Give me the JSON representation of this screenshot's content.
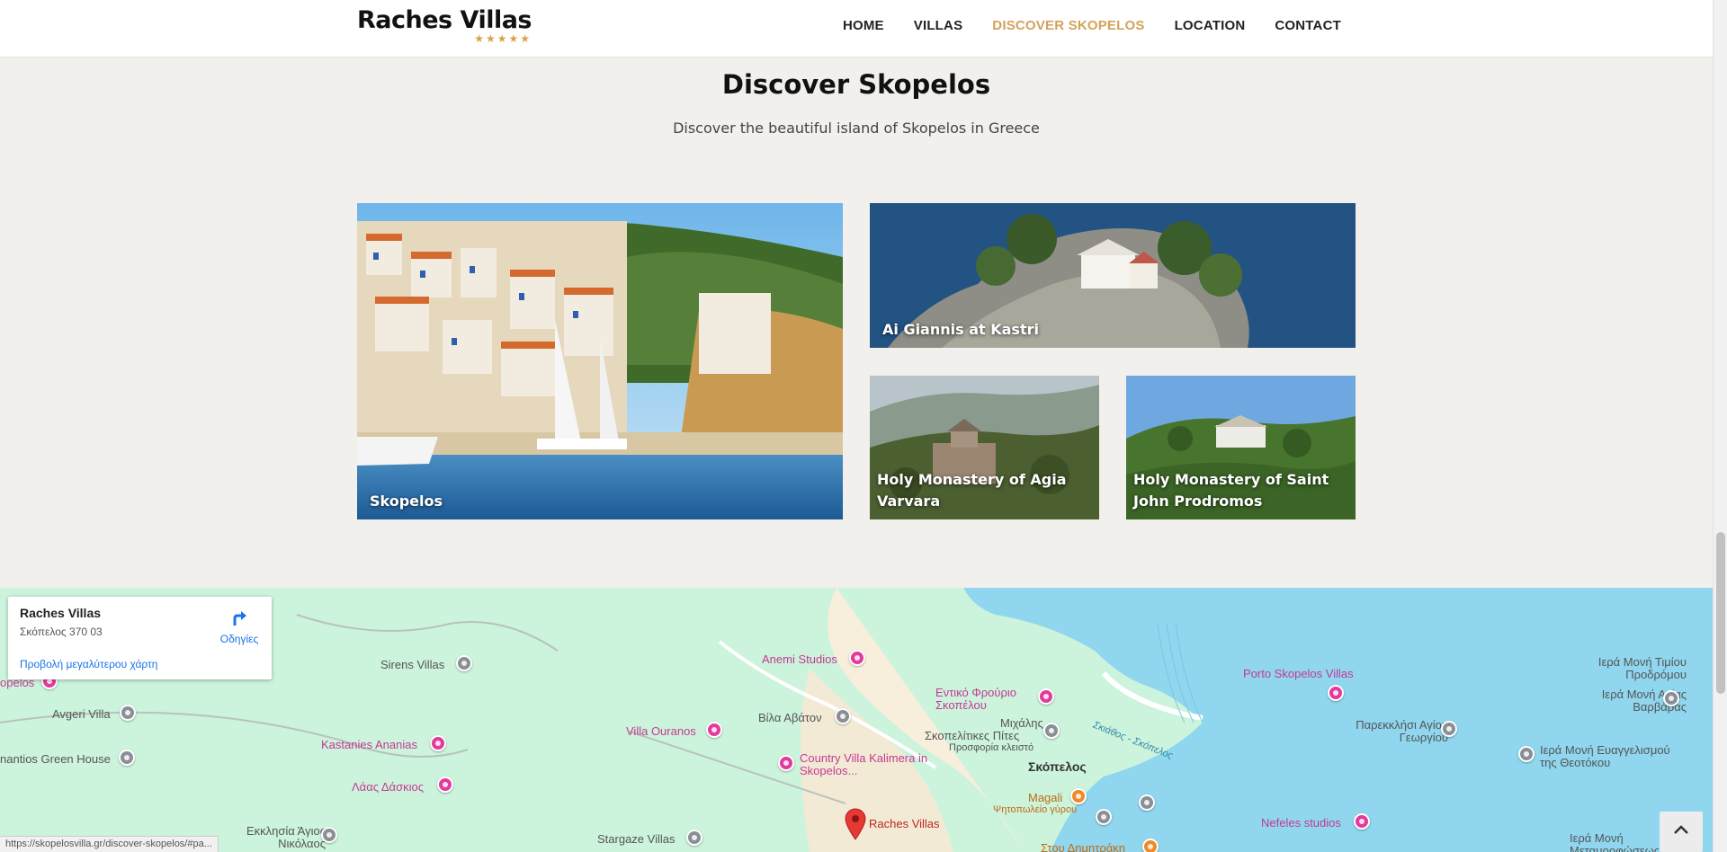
{
  "header": {
    "logo": "Raches Villas",
    "stars": "★★★★★",
    "nav": [
      "HOME",
      "VILLAS",
      "DISCOVER SKOPELOS",
      "LOCATION",
      "CONTACT"
    ]
  },
  "page": {
    "title": "Discover Skopelos",
    "subtitle": "Discover the beautiful island of Skopelos in Greece"
  },
  "cards": [
    {
      "label": "Skopelos"
    },
    {
      "label": "Ai Giannis at Kastri"
    },
    {
      "label": "Holy Monastery of Agia Varvara"
    },
    {
      "label": "Holy Monastery of Saint John Prodromos"
    }
  ],
  "map": {
    "info": {
      "title": "Raches Villas",
      "address": "Σκόπελος 370 03",
      "directions": "Οδηγίες",
      "larger_map": "Προβολή μεγαλύτερου χάρτη"
    },
    "places": [
      "Sirens Villas",
      "Anemi Studios",
      "Εντικό Φρούριο Σκοπέλου",
      "Porto Skopelos Villas",
      "Ιερά Μονή Τιμίου Προδρόμου",
      "Ιερά Μονή Αγίας Βαρβάρας",
      "Avgeri Villa",
      "Βίλα Αβάτον",
      "Μιχάλης",
      "Σκοπελίτικες Πίτες",
      "Προσφορία κλειστό",
      "Παρεκκλήσι Αγίου Γεωργίου",
      "Villa Ouranos",
      "Kastanies Ananias",
      "Country Villa Kalimera in Skopelos...",
      "Σκόπελος",
      "Σκιάθος - Σκόπελος",
      "Ιερά Μονή Ευαγγελισμού της Θεοτόκου",
      "nantios Green House",
      "Λάας Δάσκιος",
      "Magali",
      "Ψητοπωλείο γύρου",
      "Raches Villas",
      "Nefeles studios",
      "Stargaze Villas",
      "Εκκλησία Άγιος Νικόλαος",
      "Στου Δημητράκη",
      "Ιερά Μονή Μεταμορφώσεως",
      "opelos"
    ]
  },
  "status_url": "https://skopelosvilla.gr/discover-skopelos/#pa...",
  "colors": {
    "accent": "#d3a35a",
    "map_land": "#ccf3dc",
    "map_sea": "#8fd6ee"
  }
}
